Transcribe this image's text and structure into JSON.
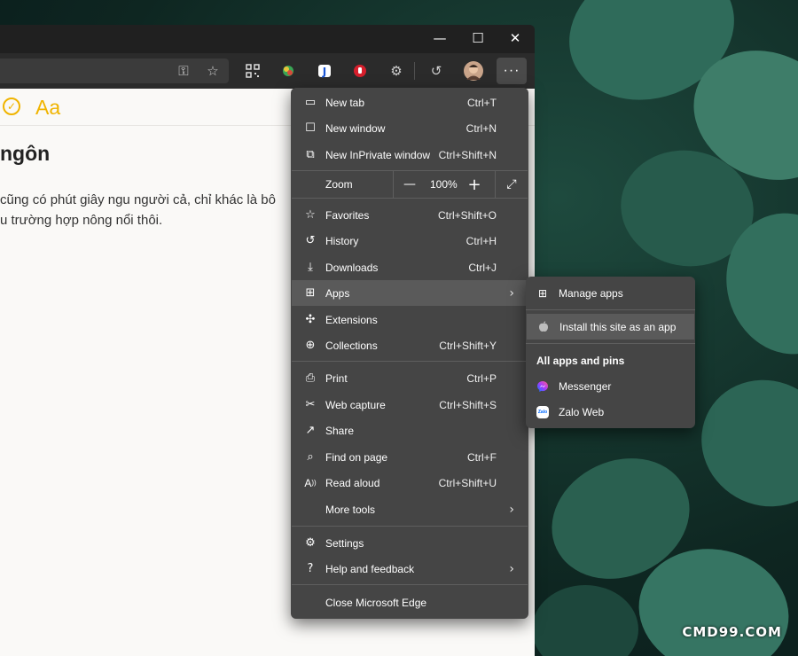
{
  "watermark": "CMD99.COM",
  "window_controls": {
    "minimize": "—",
    "maximize": "☐",
    "close": "✕"
  },
  "toolbar": {
    "more_label": "···"
  },
  "page": {
    "aa_label": "Aa",
    "title": "ngôn",
    "lines": [
      "cũng có phút giây ngu người cả, chỉ khác là bô",
      "u trường hợp nông nổi thôi."
    ]
  },
  "menu": {
    "items": [
      {
        "label": "New tab",
        "shortcut": "Ctrl+T"
      },
      {
        "label": "New window",
        "shortcut": "Ctrl+N"
      },
      {
        "label": "New InPrivate window",
        "shortcut": "Ctrl+Shift+N"
      },
      {
        "label": "Favorites",
        "shortcut": "Ctrl+Shift+O"
      },
      {
        "label": "History",
        "shortcut": "Ctrl+H"
      },
      {
        "label": "Downloads",
        "shortcut": "Ctrl+J"
      },
      {
        "label": "Apps",
        "shortcut": ""
      },
      {
        "label": "Extensions",
        "shortcut": ""
      },
      {
        "label": "Collections",
        "shortcut": "Ctrl+Shift+Y"
      },
      {
        "label": "Print",
        "shortcut": "Ctrl+P"
      },
      {
        "label": "Web capture",
        "shortcut": "Ctrl+Shift+S"
      },
      {
        "label": "Share",
        "shortcut": ""
      },
      {
        "label": "Find on page",
        "shortcut": "Ctrl+F"
      },
      {
        "label": "Read aloud",
        "shortcut": "Ctrl+Shift+U"
      },
      {
        "label": "More tools",
        "shortcut": ""
      },
      {
        "label": "Settings",
        "shortcut": ""
      },
      {
        "label": "Help and feedback",
        "shortcut": ""
      },
      {
        "label": "Close Microsoft Edge",
        "shortcut": ""
      }
    ],
    "zoom": {
      "label": "Zoom",
      "value": "100%",
      "minus": "—",
      "plus": "+"
    }
  },
  "submenu": {
    "manage_apps": "Manage apps",
    "install_site": "Install this site as an app",
    "section_header": "All apps and pins",
    "apps": [
      {
        "label": "Messenger",
        "icon": "messenger-icon"
      },
      {
        "label": "Zalo Web",
        "icon": "zalo-icon",
        "icon_text": "Zalo"
      }
    ]
  },
  "colors": {
    "accent_yellow": "#f0b400",
    "menu_bg": "#454545",
    "menu_highlight": "#5a5a5a",
    "browser_chrome": "#202020",
    "messenger": "#a33bff",
    "zalo": "#0068ff"
  }
}
